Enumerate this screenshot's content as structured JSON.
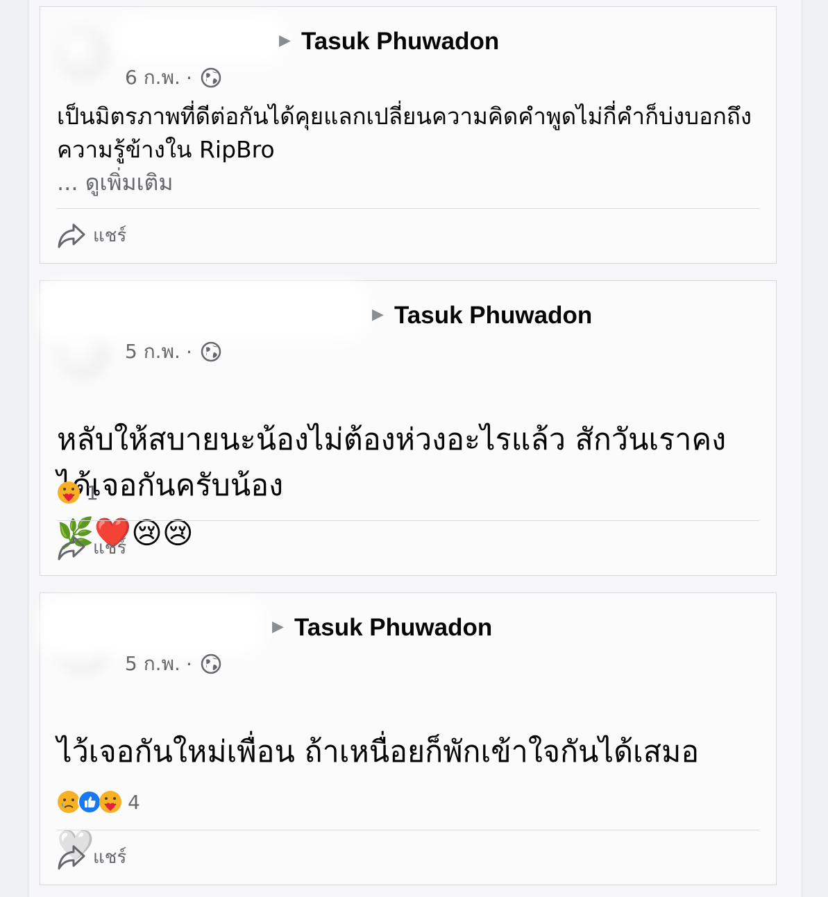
{
  "posts": [
    {
      "target": "Tasuk Phuwadon",
      "date": "6 ก.พ.",
      "separator": "·",
      "audience_icon": "globe-icon",
      "text": "เป็นมิตรภาพที่ดีต่อกันได้คุยแลกเปลี่ยนความคิดคำพูดไม่กี่คำก็บ่งบอกถึงความรู้ข้างใน RipBro",
      "see_more": "... ดูเพิ่มเติม",
      "emojis": [],
      "reactions": [],
      "reaction_count": "",
      "share_label": "แชร์"
    },
    {
      "target": "Tasuk Phuwadon",
      "date": "5 ก.พ.",
      "separator": "·",
      "audience_icon": "globe-icon",
      "text": "หลับให้สบายนะน้องไม่ต้องห่วงอะไรแล้ว สักวันเราคงได้เจอกันครับน้อง",
      "emojis": [
        "🌿",
        "❤️",
        "😢",
        "😢"
      ],
      "reactions": [
        "care"
      ],
      "reaction_count": "1",
      "share_label": "แชร์"
    },
    {
      "target": "Tasuk Phuwadon",
      "date": "5 ก.พ.",
      "separator": "·",
      "audience_icon": "globe-icon",
      "text": "ไว้เจอกันใหม่เพื่อน ถ้าเหนื่อยก็พักเข้าใจกันได้เสมอ",
      "emojis": [
        "🤍"
      ],
      "reactions": [
        "sad",
        "like",
        "care"
      ],
      "reaction_count": "4",
      "share_label": "แชร์"
    }
  ],
  "colors": {
    "secondary_text": "#65676b",
    "like_blue": "#1877f2",
    "reaction_yellow": "#f7b125",
    "heart_red": "#e41e3f"
  }
}
